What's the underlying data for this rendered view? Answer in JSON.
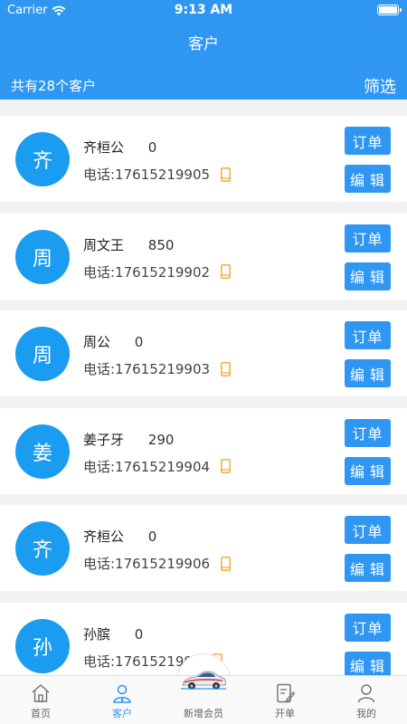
{
  "status": {
    "carrier": "Carrier",
    "time": "9:13 AM"
  },
  "nav": {
    "title": "客户"
  },
  "summary": {
    "count_text": "共有28个客户",
    "filter_label": "筛选"
  },
  "customers": [
    {
      "avatar_char": "齐",
      "name": "齐桓公",
      "points": "0",
      "phone": "电话:17615219905",
      "order_label": "订单",
      "edit_label": "编辑"
    },
    {
      "avatar_char": "周",
      "name": "周文王",
      "points": "850",
      "phone": "电话:17615219902",
      "order_label": "订单",
      "edit_label": "编辑"
    },
    {
      "avatar_char": "周",
      "name": "周公",
      "points": "0",
      "phone": "电话:17615219903",
      "order_label": "订单",
      "edit_label": "编辑"
    },
    {
      "avatar_char": "姜",
      "name": "姜子牙",
      "points": "290",
      "phone": "电话:17615219904",
      "order_label": "订单",
      "edit_label": "编辑"
    },
    {
      "avatar_char": "齐",
      "name": "齐桓公",
      "points": "0",
      "phone": "电话:17615219906",
      "order_label": "订单",
      "edit_label": "编辑"
    },
    {
      "avatar_char": "孙",
      "name": "孙膑",
      "points": "0",
      "phone": "电话:1761521990",
      "order_label": "订单",
      "edit_label": "编辑"
    }
  ],
  "tabs": [
    {
      "label": "首页",
      "icon": "home-icon"
    },
    {
      "label": "客户",
      "icon": "customer-icon"
    },
    {
      "label": "新增会员",
      "icon": "car-icon"
    },
    {
      "label": "开单",
      "icon": "order-form-icon"
    },
    {
      "label": "我的",
      "icon": "profile-icon"
    }
  ],
  "colors": {
    "primary": "#2f97f2",
    "avatar": "#1a9cf0",
    "phone_icon": "#f5a623"
  }
}
